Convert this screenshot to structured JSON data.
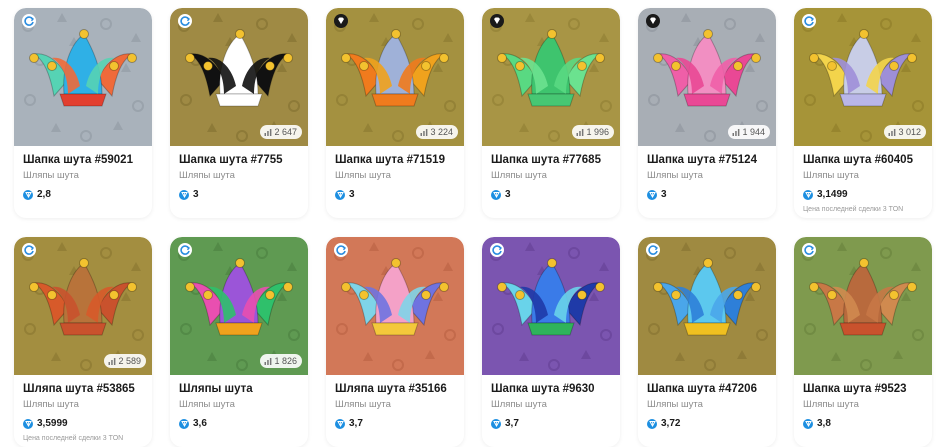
{
  "labels": {
    "collection": "Шляпы шута"
  },
  "items": [
    {
      "name": "Шапка шута #59021",
      "collection": "Шляпы шута",
      "price": "2,8",
      "supply": "",
      "last_sale": "",
      "badge": "check",
      "bg": "#a9b2bb",
      "pattern": "#9aa3ac",
      "hat": [
        "#56d3b4",
        "#2fb0e6",
        "#ef6a3a"
      ],
      "band": "#e23f2f"
    },
    {
      "name": "Шапка шута #7755",
      "collection": "Шляпы шута",
      "price": "3",
      "supply": "2 647",
      "last_sale": "",
      "badge": "check",
      "bg": "#9f8a44",
      "pattern": "#8d7a38",
      "hat": [
        "#111111",
        "#ffffff",
        "#111111"
      ],
      "band": "#ffffff"
    },
    {
      "name": "Шапка шута #71519",
      "collection": "Шляпы шута",
      "price": "3",
      "supply": "3 224",
      "last_sale": "",
      "badge": "diamond",
      "bg": "#a49140",
      "pattern": "#948236",
      "hat": [
        "#f07b1d",
        "#9fb1d8",
        "#f0a21d"
      ],
      "band": "#f07b1d"
    },
    {
      "name": "Шапка шута #77685",
      "collection": "Шляпы шута",
      "price": "3",
      "supply": "1 996",
      "last_sale": "",
      "badge": "diamond",
      "bg": "#a89545",
      "pattern": "#99873a",
      "hat": [
        "#59d982",
        "#3ec46e",
        "#6be28f"
      ],
      "band": "#47c773"
    },
    {
      "name": "Шапка шута #75124",
      "collection": "Шляпы шута",
      "price": "3",
      "supply": "1 944",
      "last_sale": "",
      "badge": "diamond",
      "bg": "#a8aeb5",
      "pattern": "#989ea6",
      "hat": [
        "#ef5fa8",
        "#f18fc2",
        "#e94895"
      ],
      "band": "#e94895"
    },
    {
      "name": "Шапка шута #60405",
      "collection": "Шляпы шута",
      "price": "3,1499",
      "supply": "3 012",
      "last_sale": "Цена последней сделки 3 TON",
      "badge": "check",
      "bg": "#a69438",
      "pattern": "#97852e",
      "hat": [
        "#f3d44b",
        "#c8cde6",
        "#9e8fd8"
      ],
      "band": "#b9b6e8"
    },
    {
      "name": "Шляпа шута #53865",
      "collection": "Шляпы шута",
      "price": "3,5999",
      "supply": "2 589",
      "last_sale": "Цена последней сделки 3 TON",
      "badge": "check",
      "bg": "#a38e40",
      "pattern": "#937f36",
      "hat": [
        "#d75a2a",
        "#b8733a",
        "#c9522d"
      ],
      "band": "#c9522d"
    },
    {
      "name": "Шляпы шута",
      "collection": "Шляпы шута",
      "price": "3,6",
      "supply": "1 826",
      "last_sale": "",
      "badge": "check",
      "bg": "#5f9a52",
      "pattern": "#538a47",
      "hat": [
        "#e94fb0",
        "#9b55d8",
        "#2fc06b"
      ],
      "band": "#f0a21d"
    },
    {
      "name": "Шляпа шута #35166",
      "collection": "Шляпы шута",
      "price": "3,7",
      "supply": "",
      "last_sale": "",
      "badge": "check",
      "bg": "#d27858",
      "pattern": "#c36a4b",
      "hat": [
        "#7fd4e8",
        "#f4a1c7",
        "#6f73e0"
      ],
      "band": "#f4c83b"
    },
    {
      "name": "Шапка шута #9630",
      "collection": "Шляпы шута",
      "price": "3,7",
      "supply": "",
      "last_sale": "",
      "badge": "check",
      "bg": "#7b55b0",
      "pattern": "#6d489f",
      "hat": [
        "#69d3ea",
        "#3a7be8",
        "#1f3aa8"
      ],
      "band": "#2fb35b"
    },
    {
      "name": "Шапка шута #47206",
      "collection": "Шляпы шута",
      "price": "3,72",
      "supply": "",
      "last_sale": "",
      "badge": "check",
      "bg": "#9f8a41",
      "pattern": "#8f7b37",
      "hat": [
        "#4aa6ea",
        "#5cc8ee",
        "#2e7fd8"
      ],
      "band": "#f0c020"
    },
    {
      "name": "Шапка шута #9523",
      "collection": "Шляпы шута",
      "price": "3,8",
      "supply": "",
      "last_sale": "",
      "badge": "check",
      "bg": "#7f9a4e",
      "pattern": "#718b43",
      "hat": [
        "#c87846",
        "#b86a3d",
        "#d08a4f"
      ],
      "band": "#c9522d"
    }
  ]
}
